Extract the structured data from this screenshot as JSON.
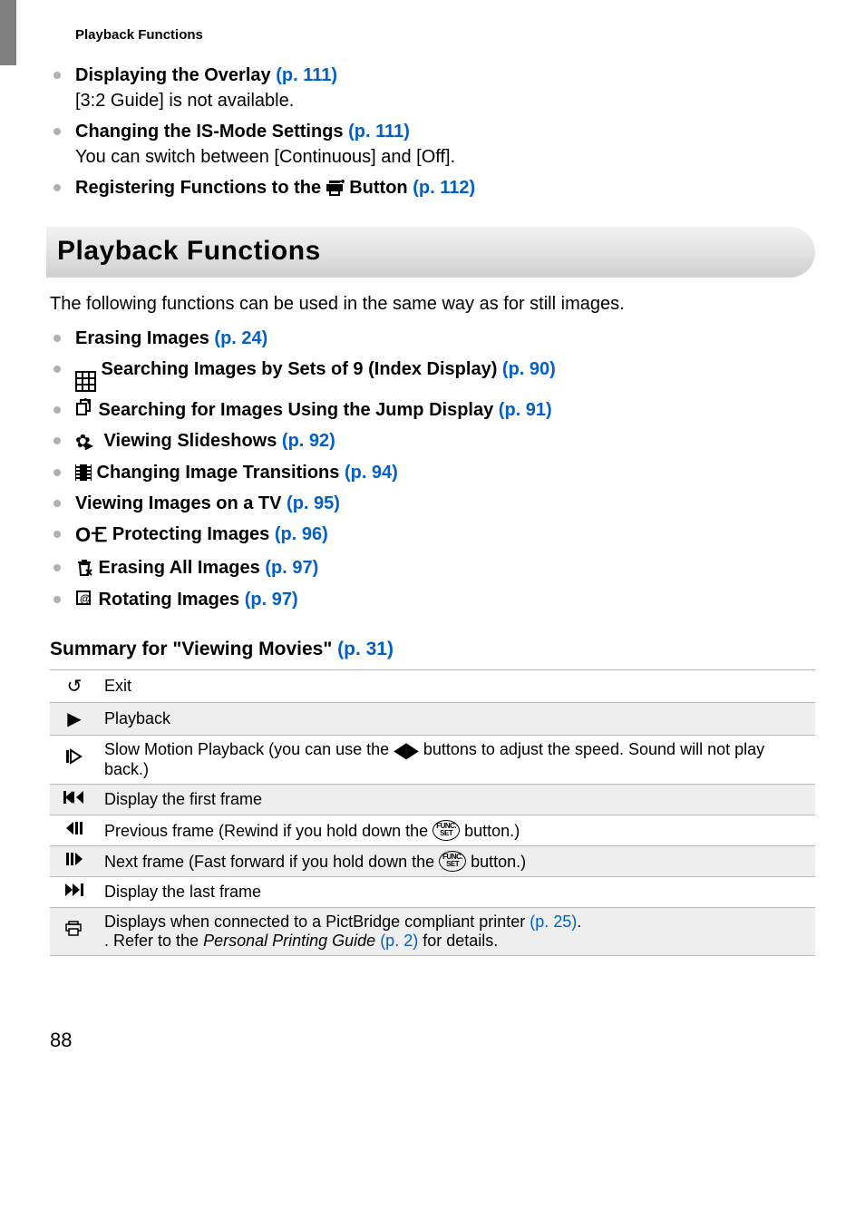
{
  "header": "Playback Functions",
  "topList": [
    {
      "title": "Displaying the Overlay ",
      "ref": "(p. 111)",
      "sub": "[3:2 Guide] is not available."
    },
    {
      "title": "Changing the IS-Mode Settings ",
      "ref": "(p. 111)",
      "sub": "You can switch between [Continuous] and [Off]."
    },
    {
      "titlePre": "Registering Functions to the ",
      "titlePost": " Button ",
      "ref": "(p. 112)",
      "hasPrintIcon": true
    }
  ],
  "sectionTitle": "Playback Functions",
  "intro": "The following functions can be used in the same way as for still images.",
  "funcList": [
    {
      "icon": null,
      "label": "Erasing Images ",
      "ref": "(p. 24)"
    },
    {
      "icon": "grid9",
      "label": " Searching Images by Sets of 9 (Index Display) ",
      "ref": "(p. 90)"
    },
    {
      "icon": "jump",
      "label": " Searching for Images Using the Jump Display ",
      "ref": "(p. 91)"
    },
    {
      "icon": "slideshow",
      "label": " Viewing Slideshows ",
      "ref": "(p. 92)"
    },
    {
      "icon": "film",
      "label": " Changing Image Transitions ",
      "ref": "(p. 94)"
    },
    {
      "icon": null,
      "label": "Viewing Images on a TV ",
      "ref": "(p. 95)"
    },
    {
      "icon": "key",
      "label": " Protecting Images ",
      "ref": "(p. 96)"
    },
    {
      "icon": "trash",
      "label": " Erasing All Images ",
      "ref": "(p. 97)"
    },
    {
      "icon": "rotate",
      "label": " Rotating Images ",
      "ref": "(p. 97)"
    }
  ],
  "summaryTitlePre": "Summary for \"Viewing Movies\" ",
  "summaryTitleRef": "(p. 31)",
  "table": [
    {
      "iconText": "↺",
      "desc": "Exit"
    },
    {
      "iconText": "▶",
      "desc": "Playback"
    },
    {
      "iconSvg": "slowplay",
      "descPre": "Slow Motion Playback (you can use the ",
      "descPost": " buttons to adjust the speed. Sound will not play back.)",
      "hasArrows": true
    },
    {
      "iconText": "❙◀◀",
      "desc": "Display the first frame"
    },
    {
      "iconText": "◀❙❙",
      "descPre": "Previous frame (Rewind if you hold down the ",
      "descPost": " button.)",
      "hasFunc": true
    },
    {
      "iconText": "❙❙▶",
      "descPre": "Next frame (Fast forward if you hold down the ",
      "descPost": " button.)",
      "hasFunc": true
    },
    {
      "iconText": "▶▶❙",
      "desc": "Display the last frame"
    },
    {
      "iconSvg": "print",
      "descParts": {
        "p1": "Displays when connected to a PictBridge compliant printer ",
        "l1": "(p. 25)",
        "p2": ".\nRefer to the ",
        "italic": "Personal Printing Guide",
        "p3": " ",
        "l2": "(p. 2)",
        "p4": " for details."
      }
    }
  ],
  "pageNumber": "88"
}
